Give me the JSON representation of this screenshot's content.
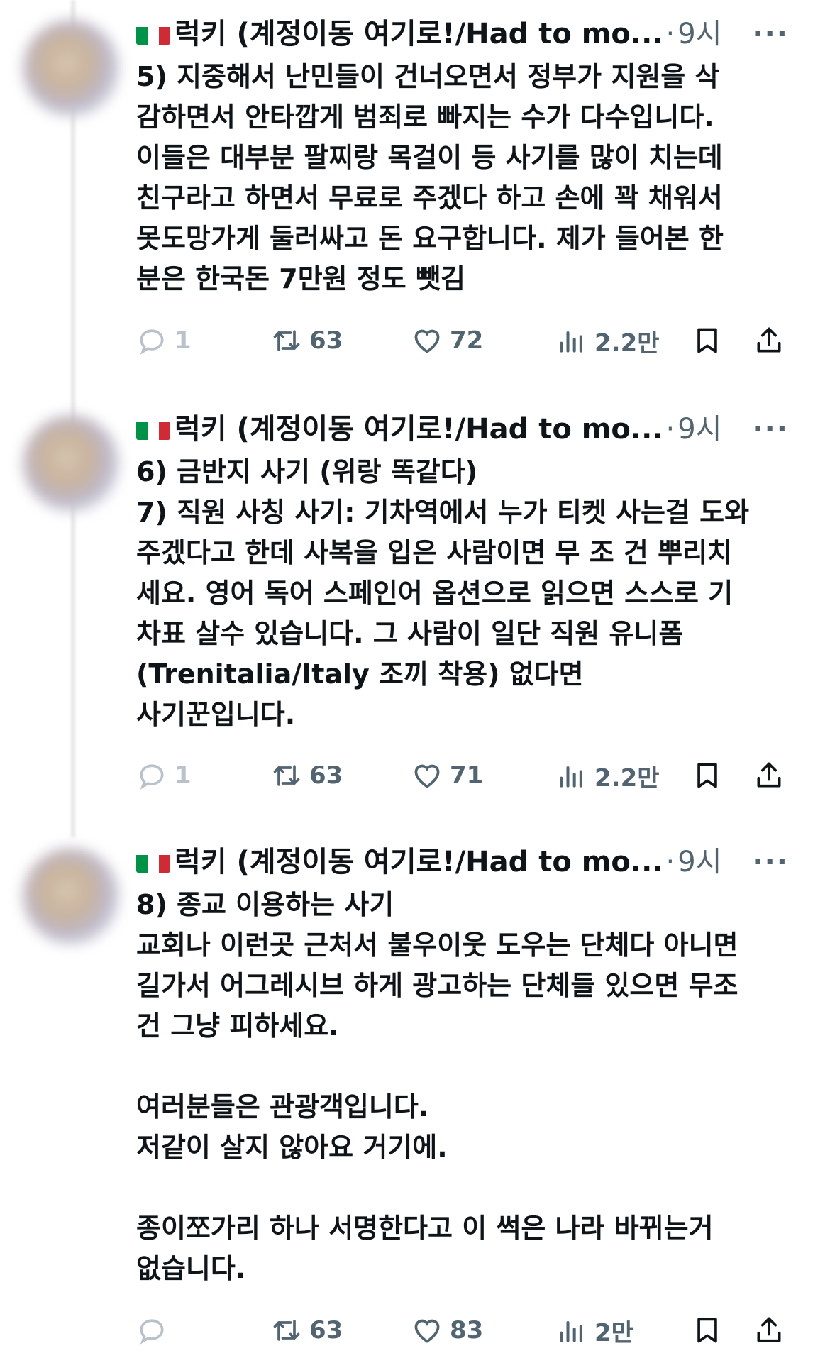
{
  "tweets": [
    {
      "author": "럭키 (계정이동 여기로!/Had to mo...",
      "separator": "·",
      "time": "9시",
      "more": "···",
      "lines": [
        "5) 지중해서 난민들이 건너오면서 정부가 지원을 삭",
        "감하면서 안타깝게 범죄로 빠지는 수가 다수입니다.",
        "이들은 대부분 팔찌랑 목걸이 등 사기를 많이 치는데",
        "친구라고 하면서 무료로 주겠다 하고 손에 꽉 채워서",
        "못도망가게 둘러싸고 돈 요구합니다. 제가 들어본 한",
        "분은 한국돈 7만원 정도 뺏김"
      ],
      "replies": "1",
      "retweets": "63",
      "likes": "72",
      "views": "2.2만"
    },
    {
      "author": "럭키 (계정이동 여기로!/Had to mo...",
      "separator": "·",
      "time": "9시",
      "more": "···",
      "lines": [
        "6) 금반지 사기 (위랑 똑같다)",
        "7) 직원 사칭 사기: 기차역에서 누가 티켓 사는걸 도와",
        "주겠다고 한데 사복을 입은 사람이면 무 조 건 뿌리치",
        "세요. 영어 독어 스페인어 옵션으로 읽으면 스스로 기",
        "차표 살수 있습니다. 그 사람이 일단 직원 유니폼",
        "(Trenitalia/Italy 조끼 착용) 없다면",
        "사기꾼입니다."
      ],
      "replies": "1",
      "retweets": "63",
      "likes": "71",
      "views": "2.2만"
    },
    {
      "author": "럭키 (계정이동 여기로!/Had to mo...",
      "separator": "·",
      "time": "9시",
      "more": "···",
      "lines": [
        "8) 종교 이용하는 사기",
        "교회나 이런곳 근처서 불우이웃 도우는 단체다 아니면",
        "길가서 어그레시브 하게 광고하는 단체들 있으면 무조",
        "건 그냥 피하세요.",
        "",
        "여러분들은 관광객입니다.",
        "저같이 살지 않아요 거기에.",
        "",
        "종이쪼가리 하나 서명한다고 이 썩은 나라 바뀌는거",
        "없습니다."
      ],
      "replies": "",
      "retweets": "63",
      "likes": "83",
      "views": "2만"
    }
  ],
  "colors": {
    "text": "#0f1419",
    "muted": "#536471",
    "flag_green": "#009246",
    "flag_white": "#ffffff",
    "flag_red": "#ce2b37"
  },
  "icons": [
    "reply-icon",
    "retweet-icon",
    "like-icon",
    "views-icon",
    "bookmark-icon",
    "share-icon",
    "more-icon",
    "italy-flag-icon"
  ]
}
